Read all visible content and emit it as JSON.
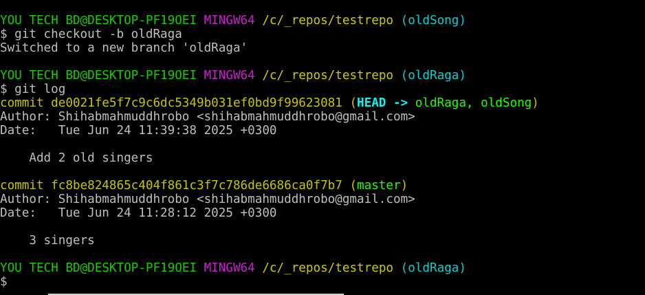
{
  "prompt1": {
    "user_host": "YOU TECH BD@DESKTOP-PF19OEI",
    "shell": "MINGW64",
    "path": "/c/_repos/testrepo",
    "branch": "(oldSong)"
  },
  "cmd1": "$ git checkout -b oldRaga",
  "out1": "Switched to a new branch 'oldRaga'",
  "prompt2": {
    "user_host": "YOU TECH BD@DESKTOP-PF19OEI",
    "shell": "MINGW64",
    "path": "/c/_repos/testrepo",
    "branch": "(oldRaga)"
  },
  "cmd2": "$ git log",
  "log": [
    {
      "commit_label": "commit de0021fe5f7c9c6dc5349b031ef0bd9f99623081",
      "paren_open": "(",
      "head": "HEAD -> ",
      "refs": "oldRaga, oldSong",
      "paren_close": ")",
      "author": "Author: Shihabmahmuddhrobo <shihabmahmuddhrobo@gmail.com>",
      "date": "Date:   Tue Jun 24 11:39:38 2025 +0300",
      "message": "    Add 2 old singers"
    },
    {
      "commit_label": "commit fc8be824865c404f861c3f7c786de6686ca0f7b7",
      "paren_open": "(",
      "refs": "master",
      "paren_close": ")",
      "author": "Author: Shihabmahmuddhrobo <shihabmahmuddhrobo@gmail.com>",
      "date": "Date:   Tue Jun 24 11:28:12 2025 +0300",
      "message": "    3 singers"
    }
  ],
  "prompt3": {
    "user_host": "YOU TECH BD@DESKTOP-PF19OEI",
    "shell": "MINGW64",
    "path": "/c/_repos/testrepo",
    "branch": "(oldRaga)"
  },
  "cmd3": "$",
  "colors": {
    "background": "#000000",
    "text": "#bfbfbf",
    "user_host": "#19cb00",
    "shell": "#cb1ed1",
    "path": "#cdcb00",
    "branch": "#0dcdcd",
    "commit": "#c7c400",
    "head": "#14f0f0",
    "ref": "#23fd00"
  }
}
